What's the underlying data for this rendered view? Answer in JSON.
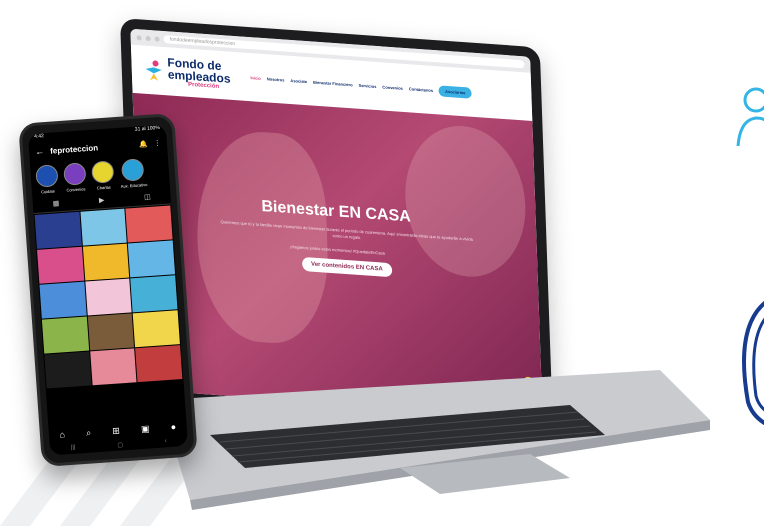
{
  "colors": {
    "brand_navy": "#0d2c6e",
    "brand_pink": "#d93a7a",
    "brand_cyan": "#3ab0e3",
    "hero_magenta": "#8e2a55"
  },
  "laptop": {
    "browser": {
      "url": "fondodeempleadosproteccion"
    },
    "site": {
      "logo": {
        "line1": "Fondo de",
        "line2": "empleados",
        "line3": "Protección"
      },
      "nav": {
        "items": [
          "Inicio",
          "Nosotros",
          "Asociate",
          "Bienestar Financiero",
          "Servicios",
          "Convenios",
          "Contáctanos"
        ],
        "active_index": 0,
        "cta": "Asociarme"
      },
      "hero": {
        "title": "Bienestar EN CASA",
        "subtitle": "Queremos que tú y tu familia vivan momentos de bienestar durante el periodo de cuarentena. Aquí encontrarás ideas que te ayudarán a vivirla como un regalo.",
        "tagline": "¡Hagamos juntos estos momentos! #QuedateEnCasa",
        "button": "Ver contenidos EN CASA"
      }
    }
  },
  "phone": {
    "status": {
      "left": "4:42",
      "right": "31 al 100%"
    },
    "profile": {
      "username": "feproteccion"
    },
    "highlights": [
      {
        "label": "Cuidate",
        "color": "#1d4fb0"
      },
      {
        "label": "Convenios",
        "color": "#7a3fbf"
      },
      {
        "label": "Charlas",
        "color": "#e6d52e"
      },
      {
        "label": "Aux. Educativo",
        "color": "#2aa0d8"
      }
    ],
    "grid_colors": [
      "#2a3f8f",
      "#7ec6e8",
      "#e35a5a",
      "#d94f8b",
      "#f0b92b",
      "#64b6e6",
      "#4c8ed9",
      "#f2c6d8",
      "#47b0d6",
      "#8bb54a",
      "#7a5c3a",
      "#f1d54a",
      "#1c1c1c",
      "#e68a9a",
      "#c23d3d"
    ]
  }
}
